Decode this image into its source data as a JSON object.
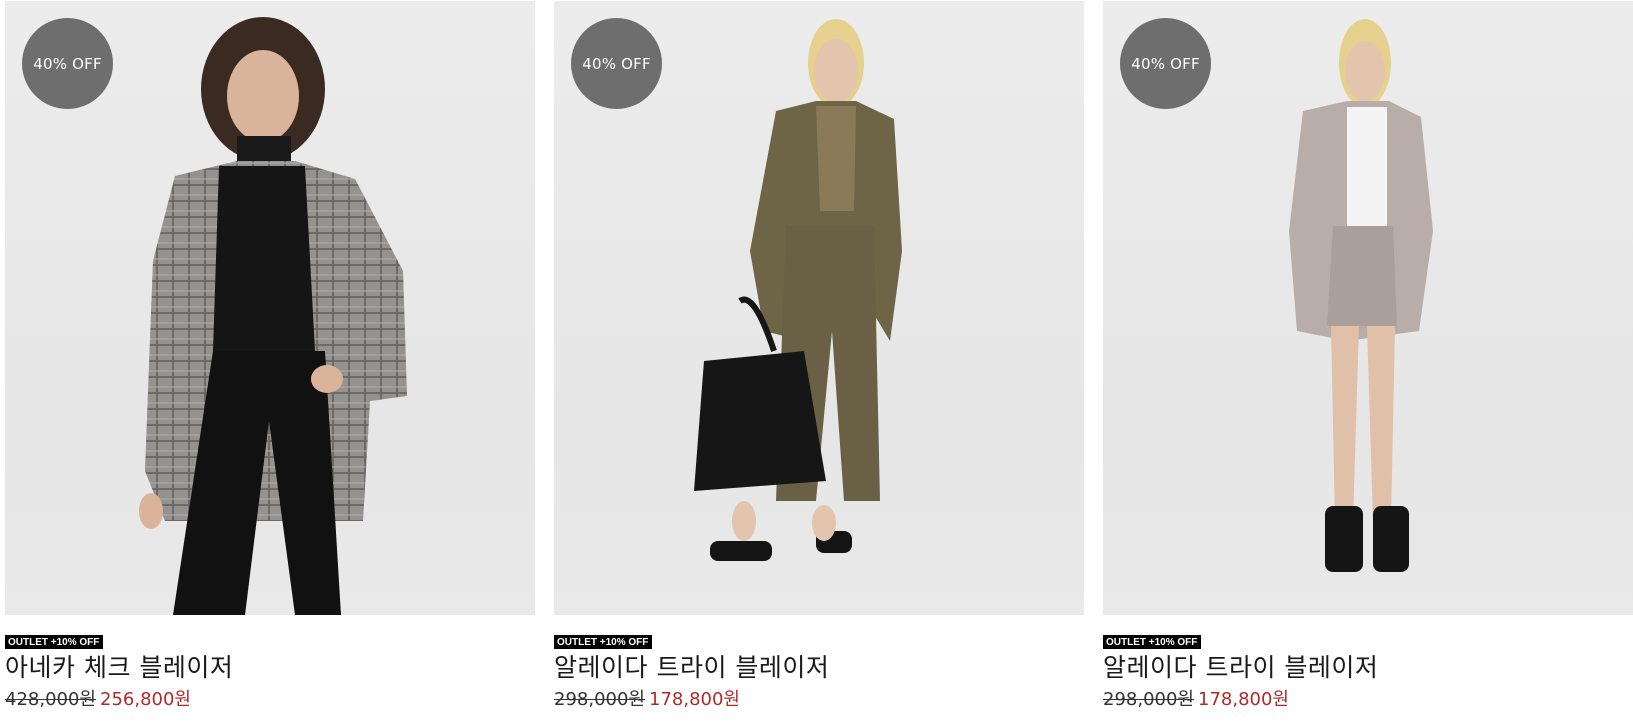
{
  "products": [
    {
      "badge": "40% OFF",
      "tag": "OUTLET +10% OFF",
      "name": "아네카 체크 블레이저",
      "original_price": "428,000원",
      "sale_price": "256,800원",
      "image": "model-check-blazer-photo"
    },
    {
      "badge": "40% OFF",
      "tag": "OUTLET +10% OFF",
      "name": "알레이다 트라이 블레이저",
      "original_price": "298,000원",
      "sale_price": "178,800원",
      "image": "model-khaki-blazer-photo"
    },
    {
      "badge": "40% OFF",
      "tag": "OUTLET +10% OFF",
      "name": "알레이다 트라이 블레이저",
      "original_price": "298,000원",
      "sale_price": "178,800원",
      "image": "model-lilac-blazer-photo"
    }
  ],
  "colors": {
    "badge_bg": "#6e6e6e",
    "tag_bg": "#000000",
    "sale_price": "#b12a2a"
  }
}
